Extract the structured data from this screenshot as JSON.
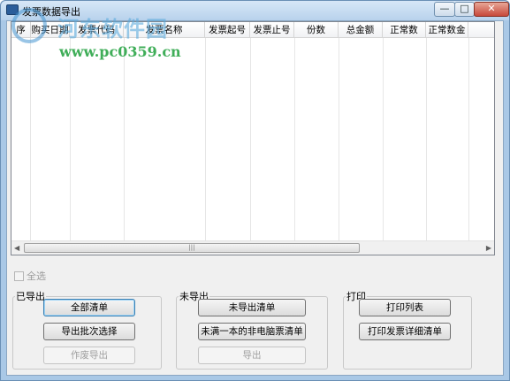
{
  "window": {
    "title": "发票数据导出"
  },
  "title_buttons": {
    "minimize": "—",
    "maximize": "□",
    "close": "✕"
  },
  "grid": {
    "columns": [
      "序",
      "购买日期",
      "发票代码",
      "发票名称",
      "发票起号",
      "发票止号",
      "份数",
      "总金额",
      "正常数",
      "正常数金"
    ],
    "rows": []
  },
  "select_all": {
    "label": "全选",
    "checked": false,
    "enabled": false
  },
  "exported_group": {
    "legend": "已导出",
    "buttons": [
      "全部清单",
      "导出批次选择",
      "作废导出"
    ]
  },
  "not_exported_group": {
    "legend": "未导出",
    "buttons": [
      "未导出清单",
      "未满一本的非电脑票清单",
      "导出"
    ]
  },
  "print_group": {
    "legend": "打印",
    "buttons": [
      "打印列表",
      "打印发票详细清单"
    ]
  },
  "watermark": {
    "text": "河东软件园",
    "url": "www.pc0359.cn"
  }
}
